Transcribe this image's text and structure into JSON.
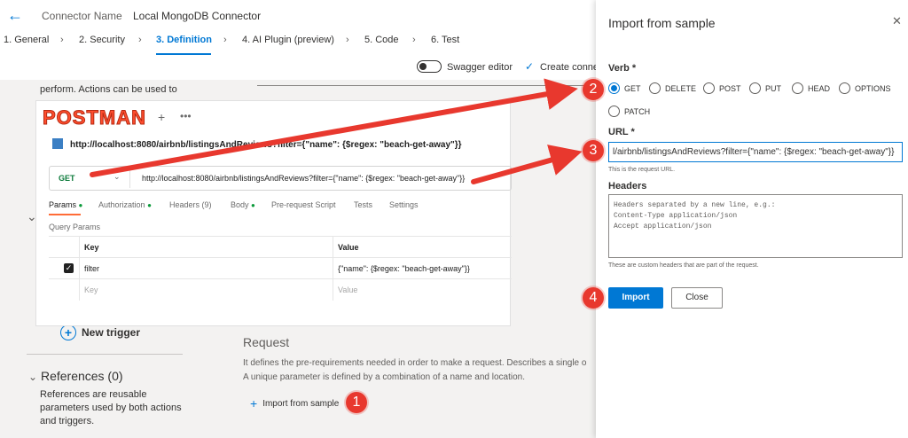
{
  "header": {
    "connector_label": "Connector Name",
    "connector_name": "Local MongoDB Connector"
  },
  "steps": [
    {
      "label": "1. General"
    },
    {
      "label": "2. Security"
    },
    {
      "label": "3. Definition"
    },
    {
      "label": "4. AI Plugin (preview)"
    },
    {
      "label": "5. Code"
    },
    {
      "label": "6. Test"
    }
  ],
  "toolbar": {
    "swagger_label": "Swagger editor",
    "create_label": "Create connec"
  },
  "left": {
    "desc_fragment": "perform. Actions can be used to",
    "new_trigger": "New trigger",
    "references_title": "References (0)",
    "references_desc": "References are reusable parameters used by both actions and triggers."
  },
  "request": {
    "title": "Request",
    "desc1": "It defines the pre-requirements needed in order to make a request. Describes a single o",
    "desc2": "A unique parameter is defined by a combination of a name and location.",
    "import_label": "Import from sample"
  },
  "postman": {
    "logo": "POSTMAN",
    "tab_title": "http://localhost:8080/airbnb/listingsAndReviews?filter={\"name\": {$regex: \"beach-get-away\"}}",
    "method": "GET",
    "url": "http://localhost:8080/airbnb/listingsAndReviews?filter={\"name\": {$regex: \"beach-get-away\"}}",
    "tabs": [
      "Params",
      "Authorization",
      "Headers (9)",
      "Body",
      "Pre-request Script",
      "Tests",
      "Settings"
    ],
    "query_params_label": "Query Params",
    "columns": [
      "Key",
      "Value"
    ],
    "rows": [
      {
        "key": "filter",
        "value": "{\"name\": {$regex: \"beach-get-away\"}}"
      },
      {
        "key": "Key",
        "value": "Value"
      }
    ]
  },
  "panel": {
    "title": "Import from sample",
    "verb_label": "Verb *",
    "verbs": [
      "GET",
      "DELETE",
      "POST",
      "PUT",
      "HEAD",
      "OPTIONS",
      "PATCH"
    ],
    "selected_verb": "GET",
    "url_label": "URL *",
    "url_value": "l/airbnb/listingsAndReviews?filter={\"name\": {$regex: \"beach-get-away\"}}",
    "url_hint": "This is the request URL.",
    "headers_label": "Headers",
    "headers_placeholder": "Headers separated by a new line, e.g.:\nContent-Type application/json\nAccept application/json",
    "headers_hint": "These are custom headers that are part of the request.",
    "import_button": "Import",
    "close_button": "Close"
  },
  "callouts": [
    "1",
    "2",
    "3",
    "4"
  ],
  "colors": {
    "accent": "#0078d4",
    "callout": "#e8382e",
    "postman_orange": "#ff6c37"
  }
}
